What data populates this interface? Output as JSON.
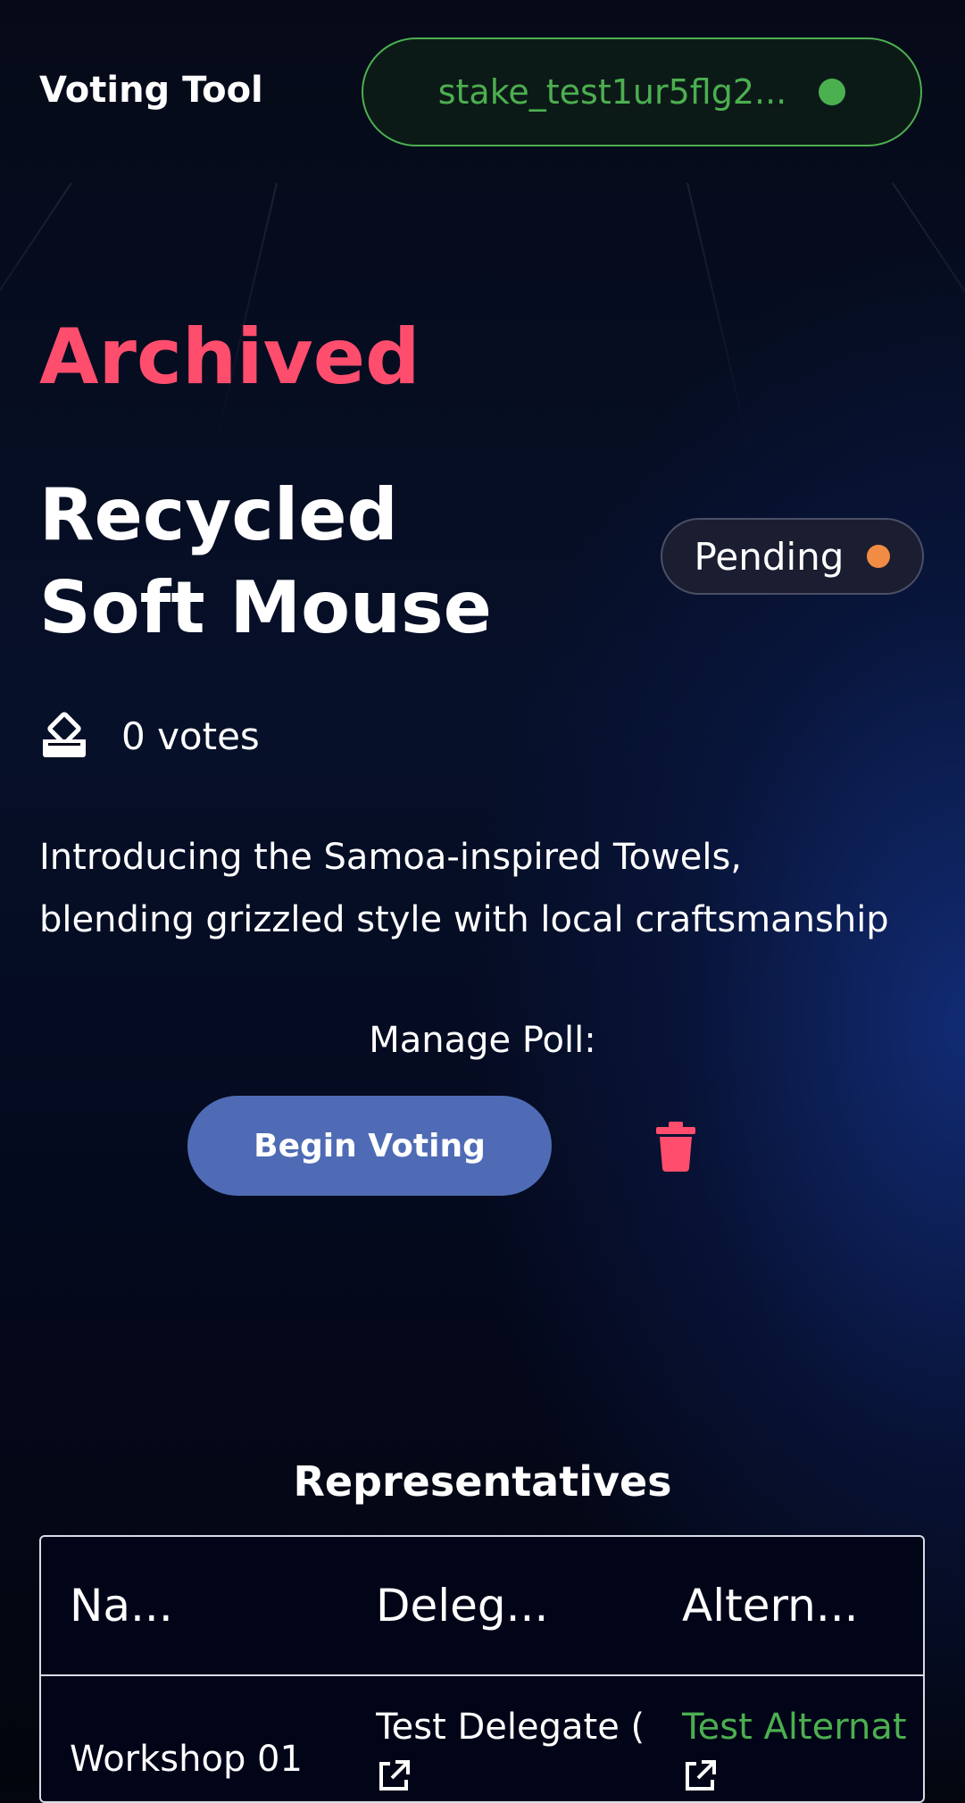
{
  "app": {
    "title": "Voting Tool"
  },
  "wallet": {
    "address": "stake_test1ur5flg2...",
    "status_color": "#4caf50"
  },
  "poll": {
    "state": "Archived",
    "title": "Recycled Soft Mouse",
    "status": "Pending",
    "status_color": "#f28c45",
    "votes": "0 votes",
    "description": "Introducing the Samoa-inspired Towels, blending grizzled style with local craftsmanship"
  },
  "manage": {
    "label": "Manage Poll:",
    "begin_label": "Begin Voting",
    "delete_icon": "trash-icon"
  },
  "representatives": {
    "title": "Representatives",
    "columns": [
      "Na...",
      "Deleg...",
      "Altern..."
    ],
    "rows": [
      {
        "name": "Workshop 01",
        "delegate": "Test Delegate (",
        "alternate": "Test Alternat"
      }
    ]
  },
  "colors": {
    "accent_red": "#ff4d6d",
    "accent_green": "#4caf50",
    "button_blue": "#4f6bb5"
  }
}
